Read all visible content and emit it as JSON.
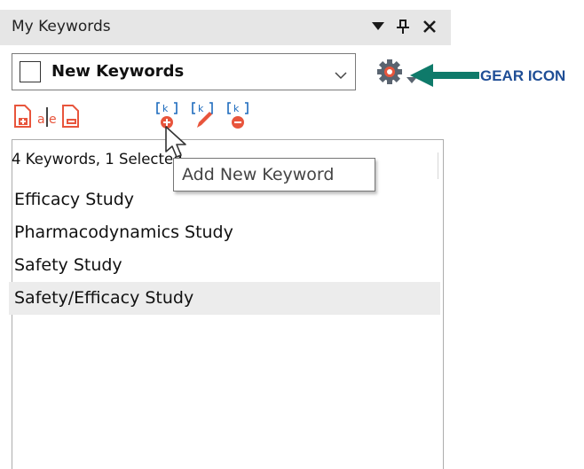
{
  "panel": {
    "title": "My Keywords",
    "window_buttons": [
      "dropdown-arrow-icon",
      "pin-icon",
      "close-icon"
    ]
  },
  "keyword_set": {
    "selected": "New Keywords",
    "checked": false
  },
  "toolbar": {
    "icons": [
      "add-keyword-set-icon",
      "rename-keyword-set-icon",
      "delete-keyword-set-icon",
      "add-keyword-icon",
      "edit-keyword-icon",
      "delete-keyword-icon"
    ]
  },
  "list": {
    "header": "4 Keywords, 1 Selected",
    "items": [
      {
        "label": "Efficacy Study",
        "selected": false
      },
      {
        "label": "Pharmacodynamics Study",
        "selected": false
      },
      {
        "label": "Safety Study",
        "selected": false
      },
      {
        "label": "Safety/Efficacy Study",
        "selected": true
      }
    ]
  },
  "tooltip": {
    "text": "Add New Keyword"
  },
  "annotation": {
    "label": "GEAR ICON",
    "color": "#1f4e96",
    "arrow_color": "#0f7a6a"
  },
  "colors": {
    "titlebar": "#e6e6e6",
    "selected_row": "#ececec",
    "icon_orange": "#e8553c",
    "icon_blue": "#1d6bbd"
  }
}
